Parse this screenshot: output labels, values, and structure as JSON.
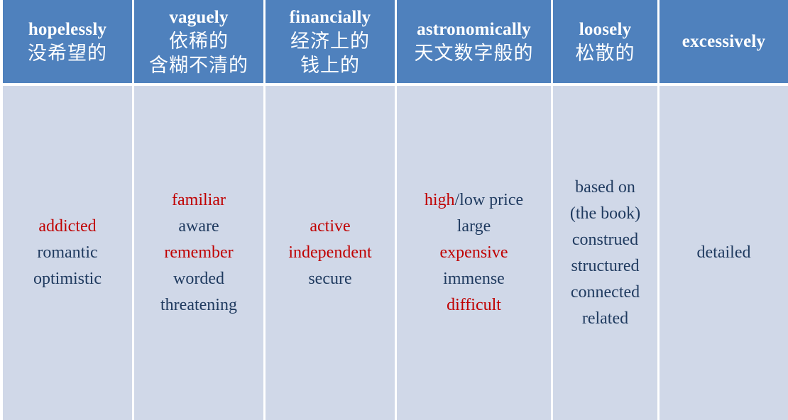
{
  "columns": [
    {
      "header_en": "hopelessly",
      "header_zh": [
        "没希望的"
      ],
      "words": [
        {
          "text": "addicted",
          "highlight": true
        },
        {
          "text": "romantic",
          "highlight": false
        },
        {
          "text": "optimistic",
          "highlight": false
        }
      ]
    },
    {
      "header_en": "vaguely",
      "header_zh": [
        "依稀的",
        "含糊不清的"
      ],
      "words": [
        {
          "text": "familiar",
          "highlight": true
        },
        {
          "text": "aware",
          "highlight": false
        },
        {
          "text": "remember",
          "highlight": true
        },
        {
          "text": "worded",
          "highlight": false
        },
        {
          "text": "threatening",
          "highlight": false
        }
      ]
    },
    {
      "header_en": "financially",
      "header_zh": [
        "经济上的",
        "钱上的"
      ],
      "words": [
        {
          "text": "active",
          "highlight": true
        },
        {
          "text": "independent",
          "highlight": true
        },
        {
          "text": "secure",
          "highlight": false
        }
      ]
    },
    {
      "header_en": "astronomically",
      "header_zh": [
        "天文数字般的"
      ],
      "words": [
        {
          "parts": [
            {
              "text": "high",
              "highlight": true
            },
            {
              "text": "/low price",
              "highlight": false
            }
          ]
        },
        {
          "text": "large",
          "highlight": false
        },
        {
          "text": "expensive",
          "highlight": true
        },
        {
          "text": "immense",
          "highlight": false
        },
        {
          "text": "difficult",
          "highlight": true
        }
      ]
    },
    {
      "header_en": "loosely",
      "header_zh": [
        "松散的"
      ],
      "words": [
        {
          "text": "based on",
          "highlight": false
        },
        {
          "text": "(the book)",
          "highlight": false
        },
        {
          "text": "construed",
          "highlight": false
        },
        {
          "text": "structured",
          "highlight": false
        },
        {
          "text": "connected",
          "highlight": false
        },
        {
          "text": "related",
          "highlight": false
        }
      ]
    },
    {
      "header_en": "excessively",
      "header_zh": [],
      "words": [
        {
          "text": "detailed",
          "highlight": false
        }
      ]
    }
  ],
  "colors": {
    "header_bg": "#4f81bd",
    "body_bg": "#d0d8e8",
    "text_normal": "#1f3a5f",
    "text_highlight": "#c00000"
  }
}
